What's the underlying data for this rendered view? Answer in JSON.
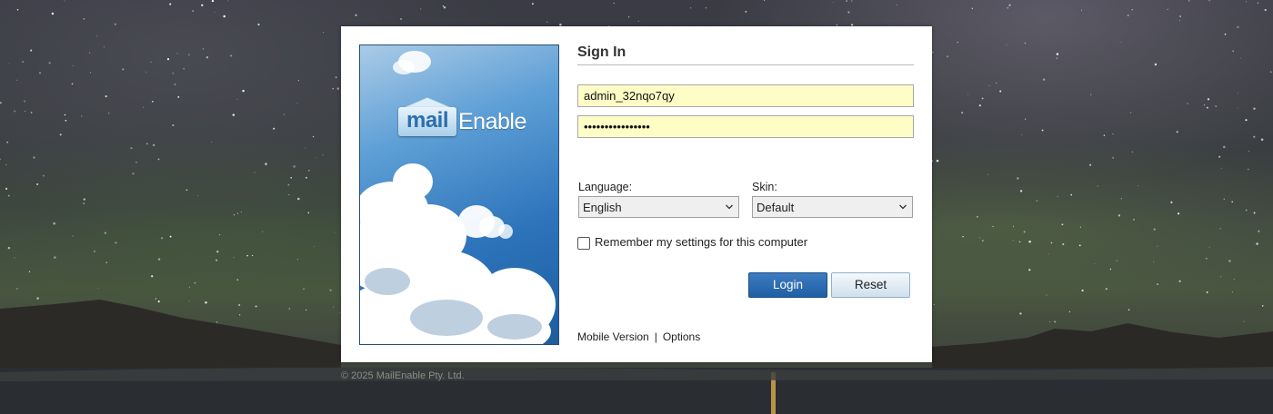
{
  "signin": {
    "heading": "Sign In",
    "username_value": "admin_32nqo7qy",
    "password_value": "••••••••••••••••"
  },
  "brand": {
    "logo_word_1": "mail",
    "logo_word_2": "Enable"
  },
  "settings": {
    "language_label": "Language:",
    "language_selected": "English",
    "skin_label": "Skin:",
    "skin_selected": "Default",
    "remember_label": "Remember my settings for this computer",
    "remember_checked": false
  },
  "actions": {
    "login_label": "Login",
    "reset_label": "Reset"
  },
  "footer": {
    "mobile_label": "Mobile Version",
    "separator": "|",
    "options_label": "Options",
    "copyright": "© 2025 MailEnable Pty. Ltd."
  },
  "icons": {
    "select_chevron": "chevron-down-icon",
    "logo_envelope": "envelope-icon"
  },
  "colors": {
    "username_field_bg": "#fefdc6",
    "login_button": "#2a6bb0",
    "brand_panel": "#2d74bb"
  }
}
